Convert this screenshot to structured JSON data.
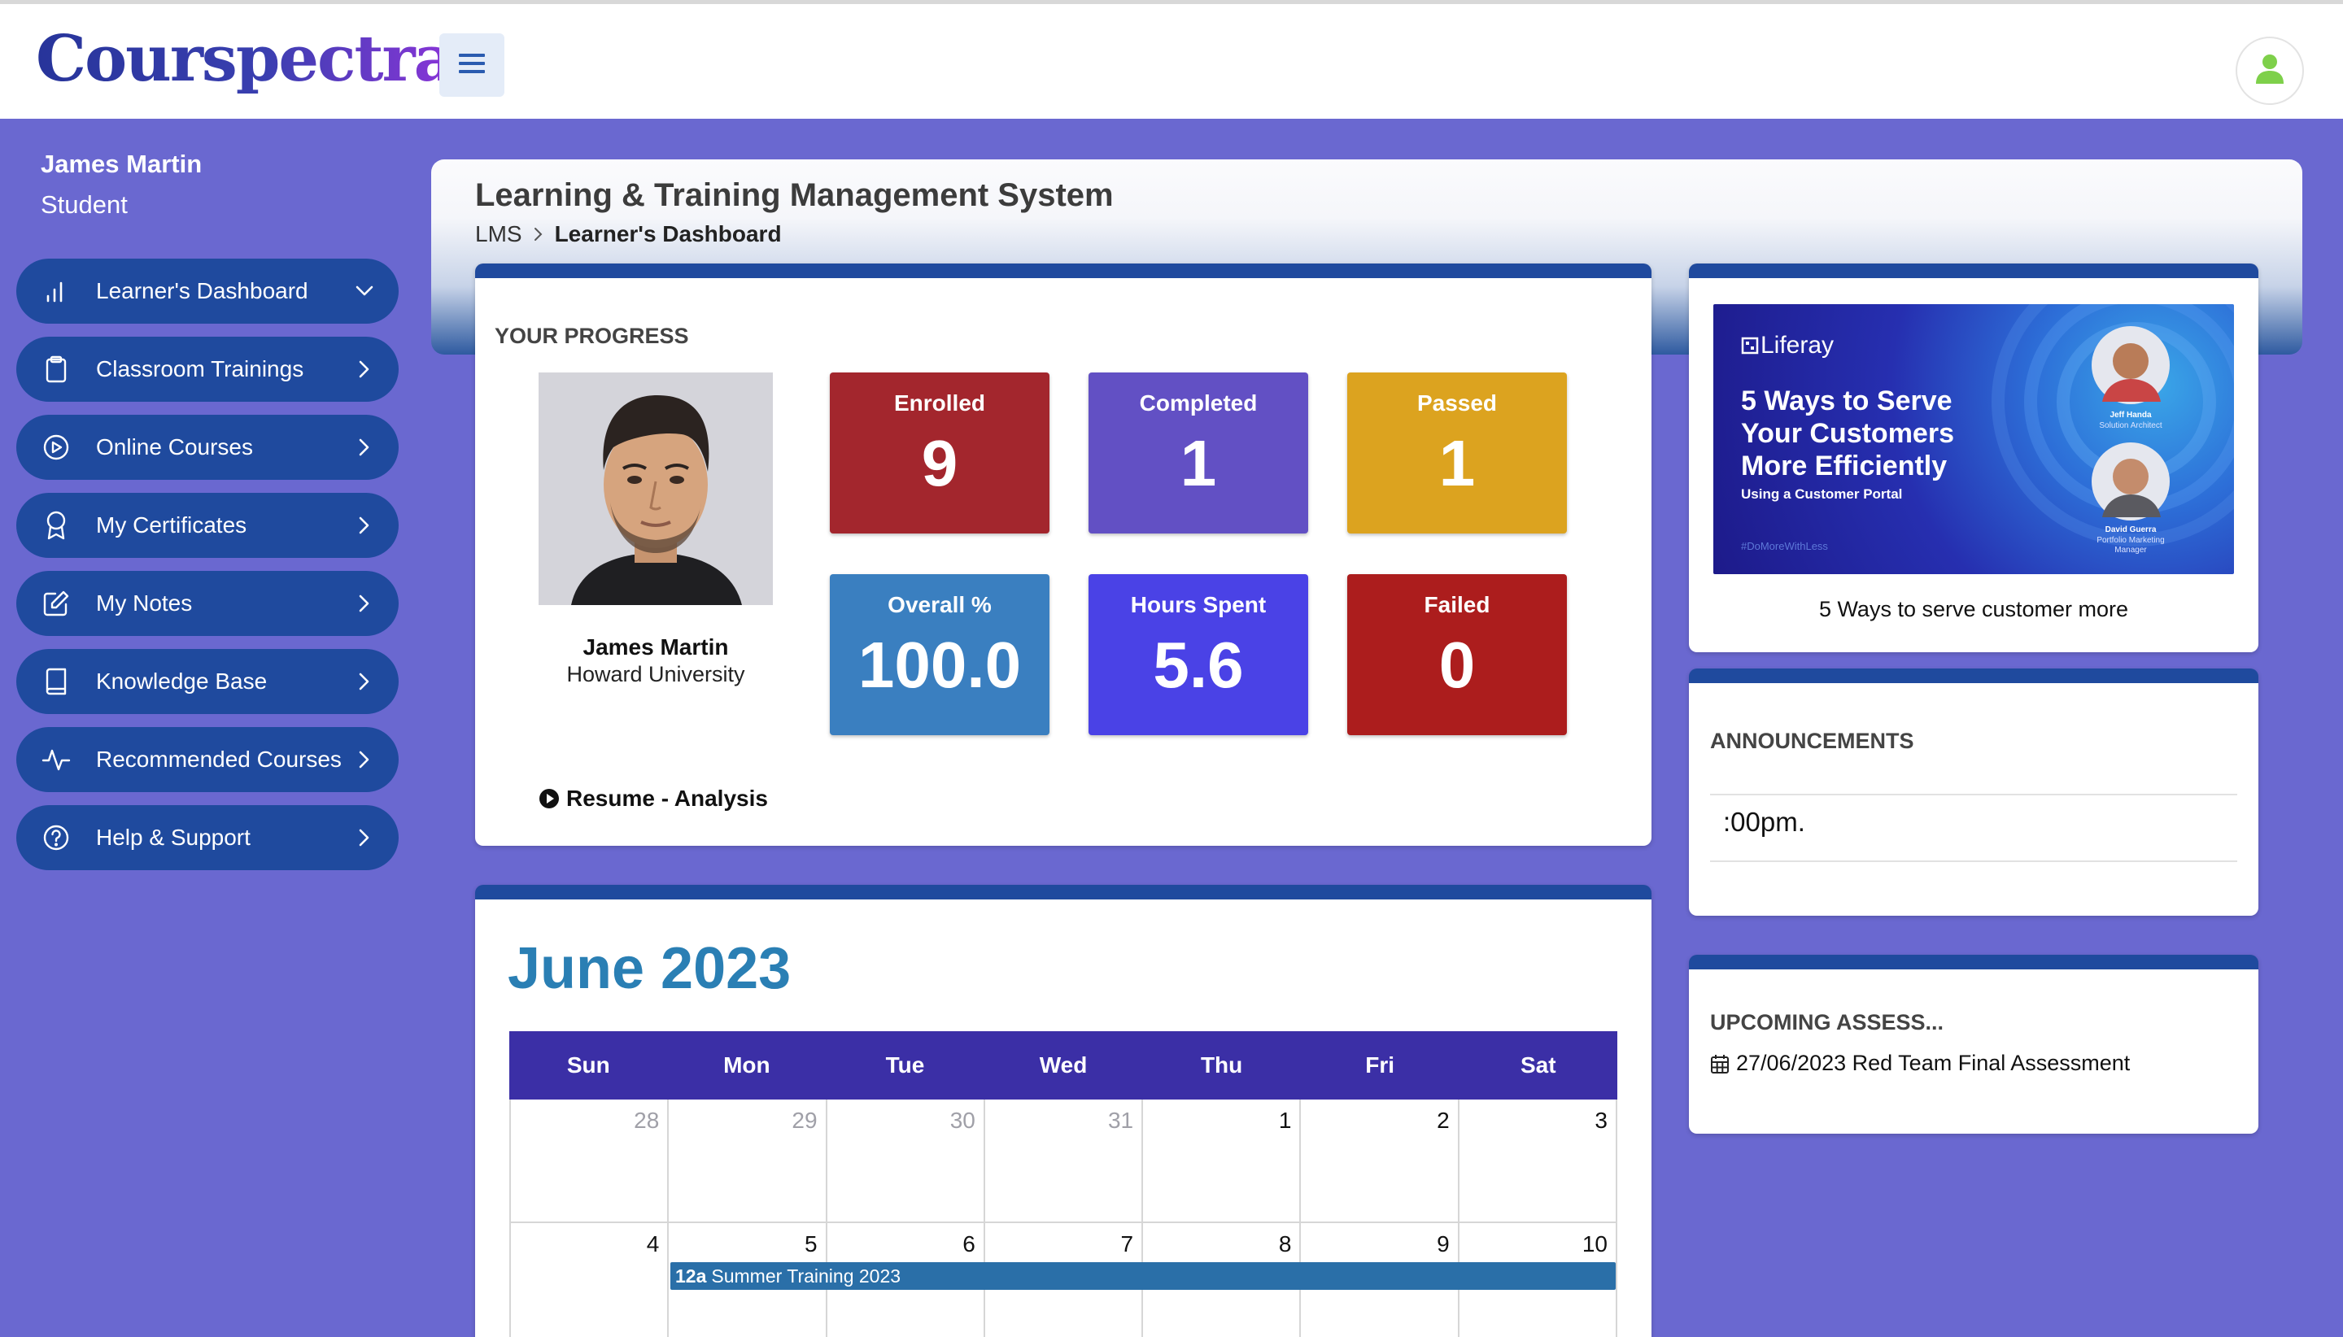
{
  "header": {
    "logo": "Courspectra",
    "menu_icon": "hamburger-icon",
    "profile_icon": "user-icon"
  },
  "user": {
    "name": "James Martin",
    "role": "Student"
  },
  "sidebar": {
    "items": [
      {
        "label": "Learner's Dashboard",
        "icon": "bar-chart-icon",
        "chevron": "down"
      },
      {
        "label": "Classroom Trainings",
        "icon": "clipboard-icon",
        "chevron": "right"
      },
      {
        "label": "Online Courses",
        "icon": "play-circle-icon",
        "chevron": "right"
      },
      {
        "label": "My Certificates",
        "icon": "award-icon",
        "chevron": "right"
      },
      {
        "label": "My Notes",
        "icon": "edit-icon",
        "chevron": "right"
      },
      {
        "label": "Knowledge Base",
        "icon": "book-icon",
        "chevron": "right"
      },
      {
        "label": "Recommended Courses",
        "icon": "activity-icon",
        "chevron": "right"
      },
      {
        "label": "Help & Support",
        "icon": "help-circle-icon",
        "chevron": "right"
      }
    ]
  },
  "page": {
    "title": "Learning & Training Management System",
    "breadcrumb_root": "LMS",
    "breadcrumb_current": "Learner's Dashboard"
  },
  "progress": {
    "heading": "YOUR PROGRESS",
    "student_name": "James Martin",
    "university": "Howard University",
    "resume_link": "Resume - Analysis",
    "stats": [
      {
        "label": "Enrolled",
        "value": "9",
        "color": "#a3262d"
      },
      {
        "label": "Completed",
        "value": "1",
        "color": "#6250c4"
      },
      {
        "label": "Passed",
        "value": "1",
        "color": "#dca31f"
      },
      {
        "label": "Overall %",
        "value": "100.0",
        "color": "#3a7fc0"
      },
      {
        "label": "Hours Spent",
        "value": "5.6",
        "color": "#4a42e6"
      },
      {
        "label": "Failed",
        "value": "0",
        "color": "#ac1d1d"
      }
    ]
  },
  "webinar": {
    "brand": "Liferay",
    "headline_1": "5 Ways to Serve",
    "headline_2": "Your Customers",
    "headline_3": "More Efficiently",
    "sub": "Using a Customer Portal",
    "hashtag": "#DoMoreWithLess",
    "speaker1_name": "Jeff Handa",
    "speaker1_title": "Solution Architect",
    "speaker2_name": "David Guerra",
    "speaker2_title_1": "Portfolio Marketing",
    "speaker2_title_2": "Manager",
    "caption": "5 Ways to serve customer more"
  },
  "announcements": {
    "heading": "ANNOUNCEMENTS",
    "items": [
      ":00pm."
    ]
  },
  "upcoming": {
    "heading": "UPCOMING ASSESS...",
    "items": [
      "27/06/2023 Red Team Final Assessment"
    ]
  },
  "calendar": {
    "title": "June 2023",
    "days": [
      "Sun",
      "Mon",
      "Tue",
      "Wed",
      "Thu",
      "Fri",
      "Sat"
    ],
    "weeks": [
      [
        {
          "d": "28",
          "other": true
        },
        {
          "d": "29",
          "other": true
        },
        {
          "d": "30",
          "other": true
        },
        {
          "d": "31",
          "other": true
        },
        {
          "d": "1"
        },
        {
          "d": "2"
        },
        {
          "d": "3"
        }
      ],
      [
        {
          "d": "4"
        },
        {
          "d": "5"
        },
        {
          "d": "6"
        },
        {
          "d": "7"
        },
        {
          "d": "8"
        },
        {
          "d": "9"
        },
        {
          "d": "10"
        }
      ]
    ],
    "event": {
      "time": "12a",
      "title": "Summer Training 2023"
    }
  },
  "colors": {
    "background": "#6a68d0",
    "sidebar_item": "#1f4a9e",
    "card_top": "#1f4a9e",
    "calendar_header": "#3b2fa6",
    "calendar_title": "#2a7fb4",
    "event": "#2a6fa8"
  }
}
